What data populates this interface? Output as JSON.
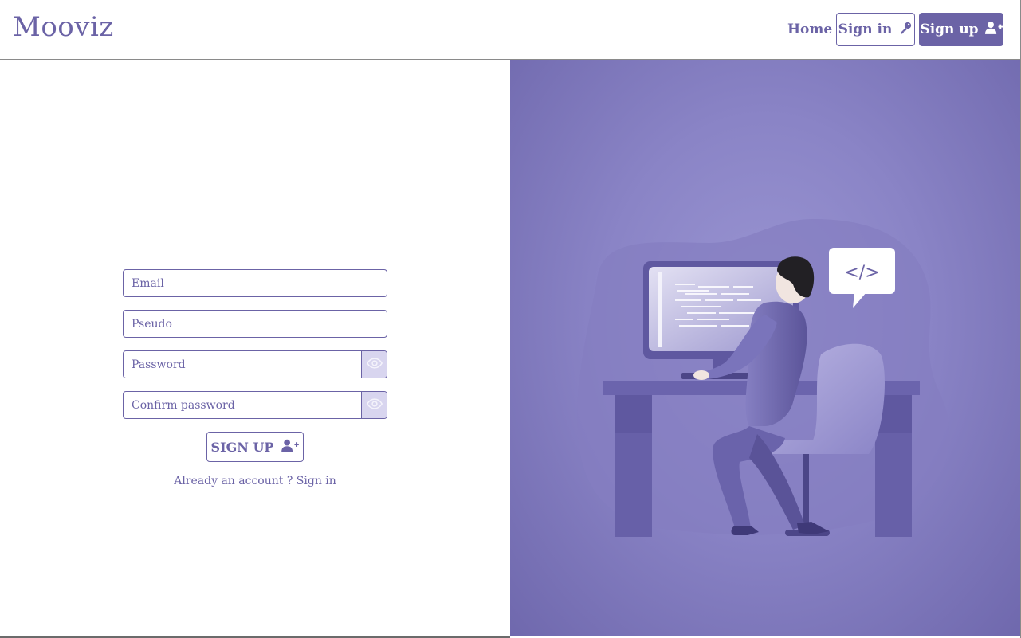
{
  "navbar": {
    "logo": "Mooviz",
    "home_label": "Home",
    "signin_label": "Sign in",
    "signup_label": "Sign up"
  },
  "form": {
    "email_placeholder": "Email",
    "pseudo_placeholder": "Pseudo",
    "password_placeholder": "Password",
    "confirm_placeholder": "Confirm password",
    "submit_label": "SIGN UP",
    "signin_prompt": "Already an account ? Sign in"
  },
  "illustration": {
    "bubble_text": "</>"
  },
  "colors": {
    "brand": "#6b63a6",
    "eye_bg": "#d8d5ef",
    "illustration_bg": "#8a84c6"
  },
  "icons": {
    "signin": "key-icon",
    "signup": "user-plus-icon",
    "toggle_password": "eye-icon"
  }
}
